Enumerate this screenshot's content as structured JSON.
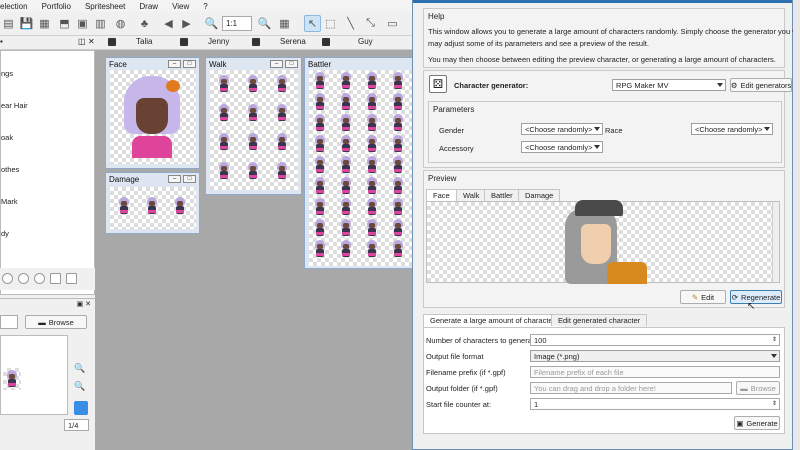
{
  "menubar": {
    "items": [
      "election",
      "Portfolio",
      "Spritesheet",
      "Draw",
      "View",
      "?"
    ]
  },
  "toolbar": {
    "zoom": "1:1"
  },
  "character_tabs": [
    "Talia",
    "Jenny",
    "Serena",
    "Guy"
  ],
  "left_panel": {
    "labels": [
      "ngs",
      "ear Hair",
      "oak",
      "othes",
      "Mark",
      "dy"
    ]
  },
  "lower_panel": {
    "browse_label": "Browse",
    "page": "1/4"
  },
  "panels": {
    "face": "Face",
    "walk": "Walk",
    "battler": "Battler",
    "damage": "Damage"
  },
  "dialog": {
    "help_title": "Help",
    "help_line1": "This window allows you to generate a large amount of characters randomly. Simply choose the generator you want. You",
    "help_line2": "may adjust some of its parameters and see a preview of the result.",
    "help_line3": "You may then choose between editing the preview character, or generating a large amount of characters.",
    "generator_label": "Character generator:",
    "generator_value": "RPG Maker MV",
    "edit_generators_label": "Edit generators",
    "parameters_title": "Parameters",
    "gender_label": "Gender",
    "gender_value": "<Choose randomly>",
    "race_label": "Race",
    "race_value": "<Choose randomly>",
    "accessory_label": "Accessory",
    "accessory_value": "<Choose randomly>",
    "preview_title": "Preview",
    "preview_tabs": [
      "Face",
      "Walk",
      "Battler",
      "Damage"
    ],
    "edit_label": "Edit",
    "regenerate_label": "Regenerate",
    "bottom_tabs": [
      "Generate a large amount of characters",
      "Edit generated character"
    ],
    "count_label": "Number of characters to generate",
    "count_value": "100",
    "format_label": "Output file format",
    "format_value": "Image (*.png)",
    "prefix_label": "Filename prefix (if *.gpf)",
    "prefix_placeholder": "Filename prefix of each file",
    "folder_label": "Output folder (if *.gpf)",
    "folder_placeholder": "You can drag and drop a folder here!",
    "folder_browse": "Browse",
    "counter_label": "Start file counter at:",
    "counter_value": "1",
    "generate_label": "Generate"
  },
  "colors": {
    "accent": "#2e6fb0",
    "canvas": "#a8a8a8",
    "hair": "#b9a7de"
  }
}
